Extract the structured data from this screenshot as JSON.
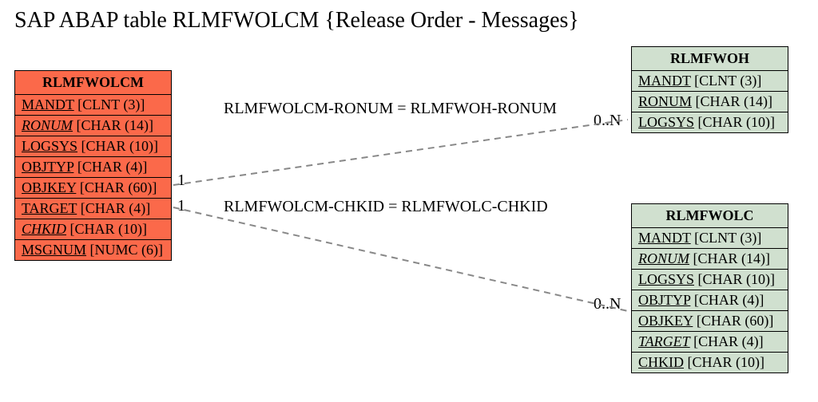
{
  "title": "SAP ABAP table RLMFWOLCM {Release Order - Messages}",
  "entities": {
    "left": {
      "name": "RLMFWOLCM",
      "rows": [
        {
          "field": "MANDT",
          "type": "[CLNT (3)]",
          "u": true,
          "i": false
        },
        {
          "field": "RONUM",
          "type": "[CHAR (14)]",
          "u": true,
          "i": true
        },
        {
          "field": "LOGSYS",
          "type": "[CHAR (10)]",
          "u": true,
          "i": false
        },
        {
          "field": "OBJTYP",
          "type": "[CHAR (4)]",
          "u": true,
          "i": false
        },
        {
          "field": "OBJKEY",
          "type": "[CHAR (60)]",
          "u": true,
          "i": false
        },
        {
          "field": "TARGET",
          "type": "[CHAR (4)]",
          "u": true,
          "i": false
        },
        {
          "field": "CHKID",
          "type": "[CHAR (10)]",
          "u": true,
          "i": true
        },
        {
          "field": "MSGNUM",
          "type": "[NUMC (6)]",
          "u": true,
          "i": false
        }
      ]
    },
    "topRight": {
      "name": "RLMFWOH",
      "rows": [
        {
          "field": "MANDT",
          "type": "[CLNT (3)]",
          "u": true,
          "i": false
        },
        {
          "field": "RONUM",
          "type": "[CHAR (14)]",
          "u": true,
          "i": false
        },
        {
          "field": "LOGSYS",
          "type": "[CHAR (10)]",
          "u": true,
          "i": false
        }
      ]
    },
    "bottomRight": {
      "name": "RLMFWOLC",
      "rows": [
        {
          "field": "MANDT",
          "type": "[CLNT (3)]",
          "u": true,
          "i": false
        },
        {
          "field": "RONUM",
          "type": "[CHAR (14)]",
          "u": true,
          "i": true
        },
        {
          "field": "LOGSYS",
          "type": "[CHAR (10)]",
          "u": true,
          "i": false
        },
        {
          "field": "OBJTYP",
          "type": "[CHAR (4)]",
          "u": true,
          "i": false
        },
        {
          "field": "OBJKEY",
          "type": "[CHAR (60)]",
          "u": true,
          "i": false
        },
        {
          "field": "TARGET",
          "type": "[CHAR (4)]",
          "u": true,
          "i": true
        },
        {
          "field": "CHKID",
          "type": "[CHAR (10)]",
          "u": true,
          "i": false
        }
      ]
    }
  },
  "relations": {
    "top": {
      "label": "RLMFWOLCM-RONUM = RLMFWOH-RONUM",
      "leftCard": "1",
      "rightCard": "0..N"
    },
    "bottom": {
      "label": "RLMFWOLCM-CHKID = RLMFWOLC-CHKID",
      "leftCard": "1",
      "rightCard": "0..N"
    }
  }
}
